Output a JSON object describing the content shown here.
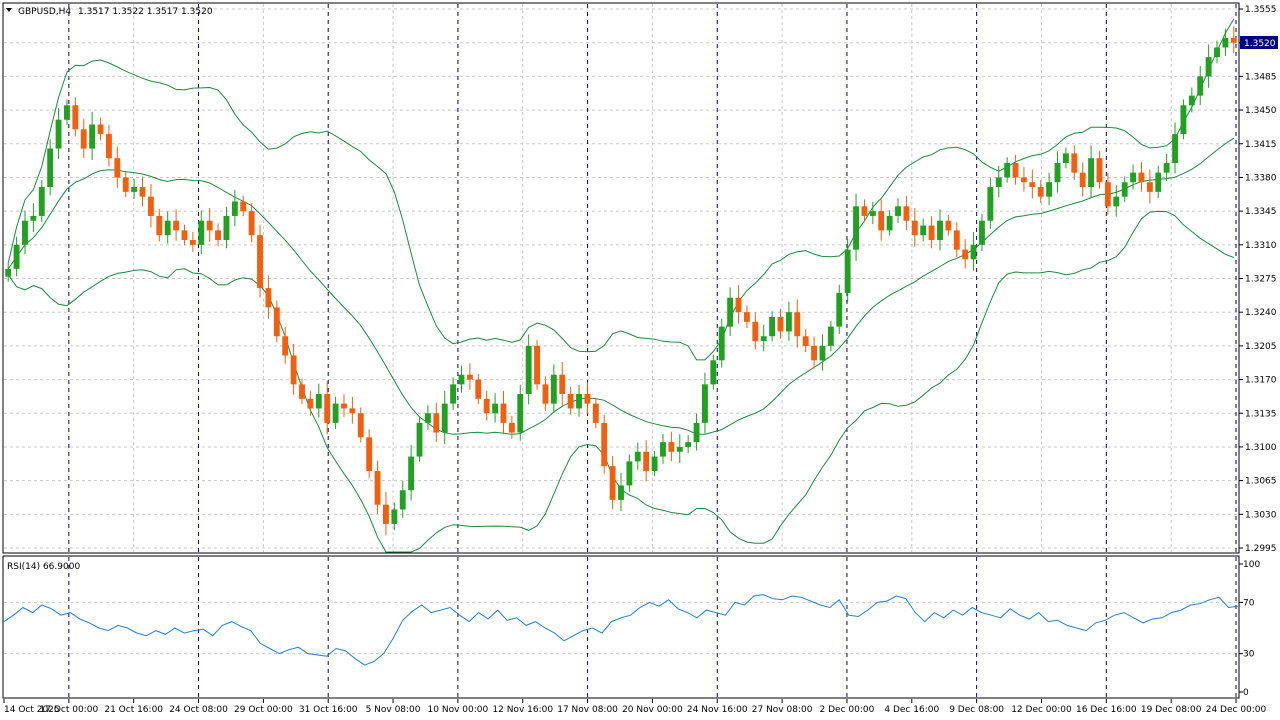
{
  "header": {
    "symbol_tf": "GBPUSD,H4",
    "ohlc": "1.3517 1.3522 1.3517 1.3520"
  },
  "rsi": {
    "label": "RSI(14) 66.9000",
    "levels": [
      "100",
      "70",
      "30",
      "0"
    ]
  },
  "current_price": "1.3520",
  "colors": {
    "bull": "#22a022",
    "bear": "#f06010",
    "bands": "#1a8a3a",
    "rsi_line": "#1e7fd8",
    "separator": "#000080",
    "grid": "#c8c8c8",
    "price_tag_bg": "#000080"
  },
  "chart_data": [
    {
      "type": "candlestick",
      "symbol": "GBPUSD",
      "timeframe": "H4",
      "ylim": [
        1.2995,
        1.3555
      ],
      "y_ticks": [
        "1.3555",
        "1.3520",
        "1.3485",
        "1.3450",
        "1.3415",
        "1.3380",
        "1.3345",
        "1.3310",
        "1.3275",
        "1.3240",
        "1.3205",
        "1.3170",
        "1.3135",
        "1.3100",
        "1.3065",
        "1.3030",
        "1.2995"
      ],
      "x_ticks": [
        "14 Oct 2025",
        "17 Oct 00:00",
        "21 Oct 16:00",
        "24 Oct 08:00",
        "29 Oct 00:00",
        "31 Oct 16:00",
        "5 Nov 08:00",
        "10 Nov 00:00",
        "12 Nov 16:00",
        "17 Nov 08:00",
        "20 Nov 00:00",
        "24 Nov 16:00",
        "27 Nov 08:00",
        "2 Dec 00:00",
        "4 Dec 16:00",
        "9 Dec 08:00",
        "12 Dec 00:00",
        "16 Dec 16:00",
        "19 Dec 08:00",
        "24 Dec 00:00"
      ],
      "close_path": [
        1.3285,
        1.331,
        1.3335,
        1.334,
        1.337,
        1.341,
        1.344,
        1.3455,
        1.343,
        1.341,
        1.3435,
        1.3425,
        1.34,
        1.338,
        1.3365,
        1.337,
        1.336,
        1.334,
        1.332,
        1.3335,
        1.3325,
        1.3315,
        1.331,
        1.3335,
        1.3325,
        1.3315,
        1.334,
        1.3355,
        1.3345,
        1.332,
        1.3265,
        1.3245,
        1.3215,
        1.3195,
        1.3165,
        1.315,
        1.314,
        1.3155,
        1.3125,
        1.3145,
        1.314,
        1.3135,
        1.311,
        1.3075,
        1.304,
        1.302,
        1.3035,
        1.3055,
        1.309,
        1.3125,
        1.3135,
        1.3115,
        1.3145,
        1.3165,
        1.3175,
        1.317,
        1.315,
        1.3135,
        1.3145,
        1.3125,
        1.3115,
        1.3155,
        1.3205,
        1.3165,
        1.3145,
        1.3175,
        1.3155,
        1.314,
        1.3155,
        1.3145,
        1.3125,
        1.308,
        1.3045,
        1.306,
        1.3085,
        1.3095,
        1.3075,
        1.309,
        1.3105,
        1.3095,
        1.31,
        1.3105,
        1.3125,
        1.3165,
        1.319,
        1.3225,
        1.3255,
        1.324,
        1.323,
        1.321,
        1.3215,
        1.3235,
        1.322,
        1.324,
        1.3215,
        1.3205,
        1.319,
        1.3205,
        1.3225,
        1.326,
        1.3305,
        1.335,
        1.334,
        1.3345,
        1.3325,
        1.334,
        1.335,
        1.3335,
        1.332,
        1.333,
        1.3315,
        1.3335,
        1.3325,
        1.3305,
        1.3295,
        1.331,
        1.3335,
        1.337,
        1.338,
        1.3395,
        1.338,
        1.3375,
        1.337,
        1.336,
        1.3375,
        1.3395,
        1.3405,
        1.3385,
        1.337,
        1.34,
        1.3375,
        1.335,
        1.336,
        1.3375,
        1.3385,
        1.3375,
        1.3365,
        1.3385,
        1.3395,
        1.3425,
        1.3455,
        1.3465,
        1.3485,
        1.3505,
        1.3515,
        1.3525,
        1.352
      ]
    },
    {
      "type": "line",
      "name": "RSI(14)",
      "ylim": [
        0,
        100
      ],
      "levels": [
        30,
        70
      ],
      "values": [
        55,
        60,
        66,
        62,
        68,
        65,
        60,
        62,
        57,
        54,
        50,
        48,
        52,
        50,
        46,
        44,
        48,
        45,
        50,
        46,
        48,
        49,
        44,
        52,
        55,
        51,
        48,
        38,
        34,
        30,
        33,
        35,
        30,
        29,
        28,
        34,
        32,
        26,
        21,
        24,
        30,
        42,
        56,
        63,
        68,
        62,
        64,
        66,
        60,
        55,
        62,
        57,
        64,
        56,
        58,
        52,
        55,
        50,
        46,
        40,
        44,
        48,
        50,
        46,
        55,
        58,
        60,
        66,
        70,
        67,
        72,
        65,
        62,
        58,
        64,
        62,
        60,
        70,
        68,
        75,
        76,
        73,
        72,
        75,
        74,
        71,
        68,
        66,
        72,
        60,
        59,
        64,
        70,
        71,
        75,
        73,
        62,
        55,
        62,
        58,
        64,
        60,
        66,
        62,
        60,
        58,
        65,
        60,
        57,
        62,
        55,
        56,
        52,
        50,
        48,
        54,
        56,
        60,
        62,
        58,
        54,
        57,
        58,
        62,
        64,
        68,
        69,
        72,
        74,
        66,
        67
      ]
    }
  ]
}
